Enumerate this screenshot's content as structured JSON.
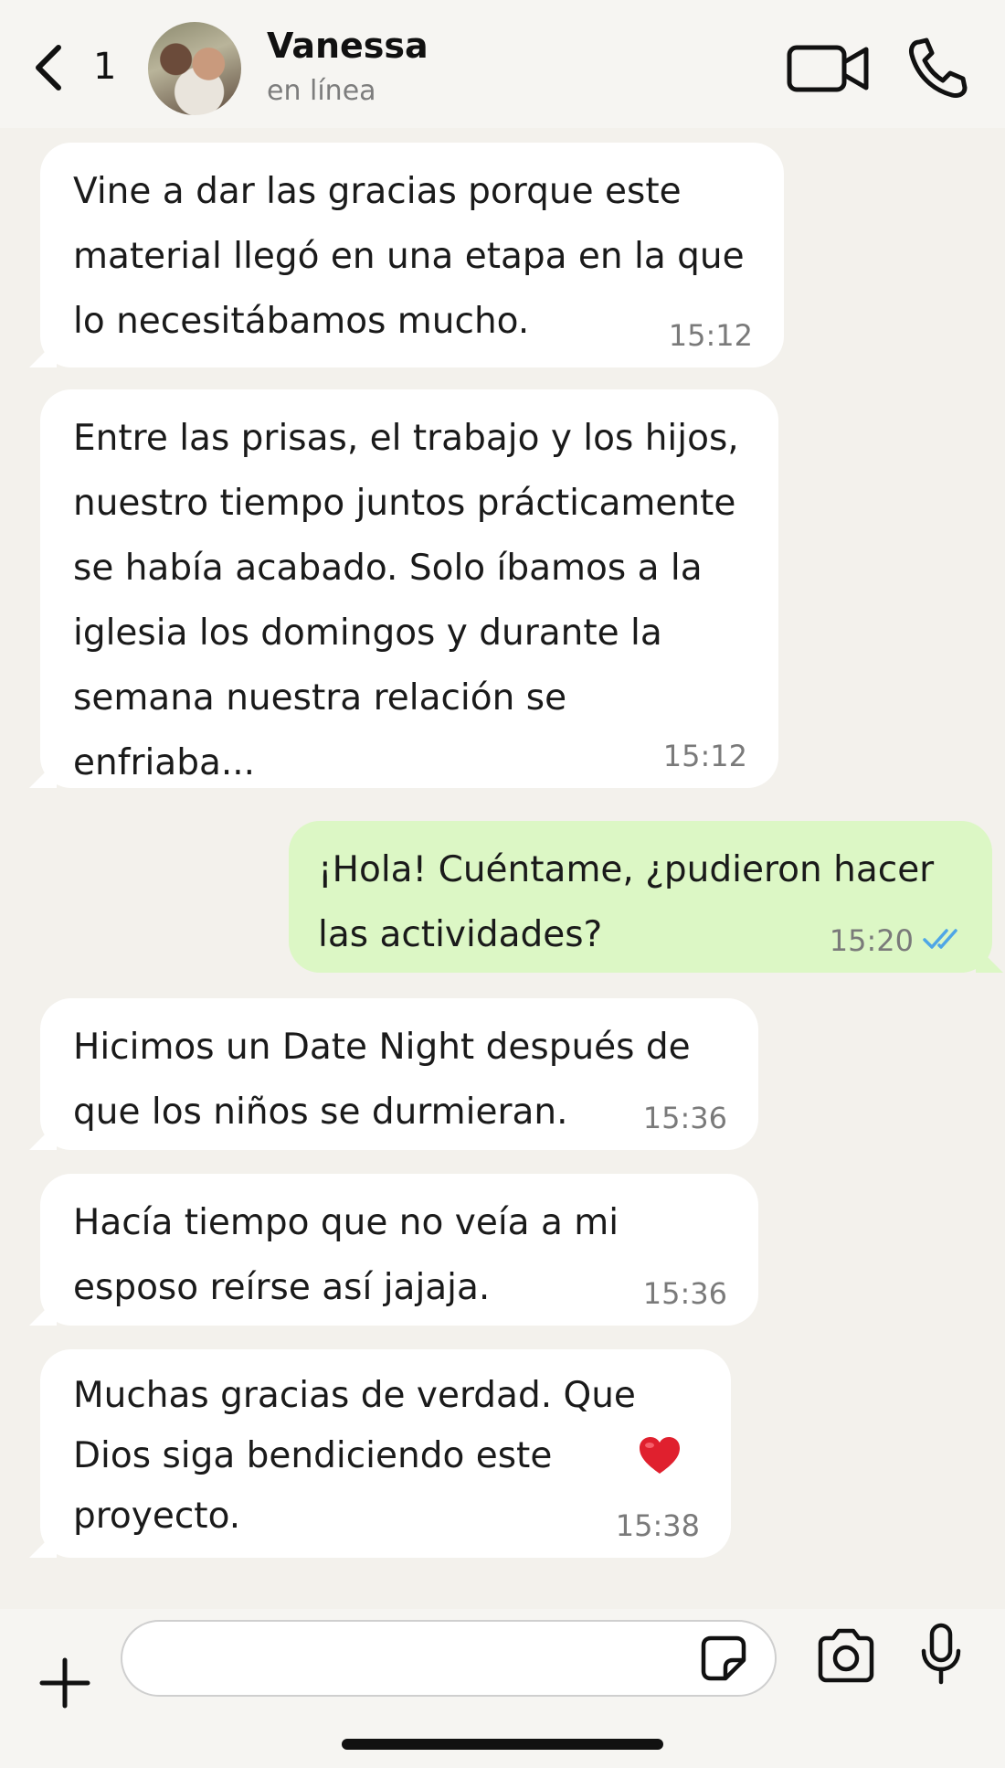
{
  "header": {
    "back_count": "1",
    "contact_name": "Vanessa",
    "contact_status": "en línea",
    "icons": {
      "back": "chevron-left-icon",
      "video": "video-camera-icon",
      "call": "phone-icon"
    }
  },
  "messages": [
    {
      "direction": "in",
      "text": "Vine a dar las gracias porque este material llegó en una etapa en la que lo necesitábamos mucho.",
      "time": "15:12"
    },
    {
      "direction": "in",
      "text": "Entre las prisas, el trabajo y los hijos, nuestro tiempo juntos prácticamente se había acabado. Solo íbamos a la iglesia los domingos y durante la semana nuestra relación se enfriaba...",
      "time": "15:12"
    },
    {
      "direction": "out",
      "text": "¡Hola! Cuéntame, ¿pudieron hacer las actividades?",
      "time": "15:20",
      "status": "read"
    },
    {
      "direction": "in",
      "text": "Hicimos un Date Night después de que los niños se durmieran.",
      "time": "15:36"
    },
    {
      "direction": "in",
      "text": "Hacía tiempo que no veía a mi esposo reírse así jajaja.",
      "time": "15:36"
    },
    {
      "direction": "in",
      "text": "Muchas gracias de verdad. Que Dios siga bendiciendo este proyecto.",
      "emoji": "❤️",
      "time": "15:38"
    }
  ],
  "composer": {
    "input_value": "",
    "icons": {
      "attach": "plus-icon",
      "sticker": "sticker-icon",
      "camera": "camera-icon",
      "mic": "microphone-icon"
    }
  },
  "colors": {
    "background": "#f3f1ec",
    "incoming_bubble": "#ffffff",
    "outgoing_bubble": "#dcf7c5",
    "read_ticks": "#4fa6e6",
    "heart": "#e0202e"
  }
}
